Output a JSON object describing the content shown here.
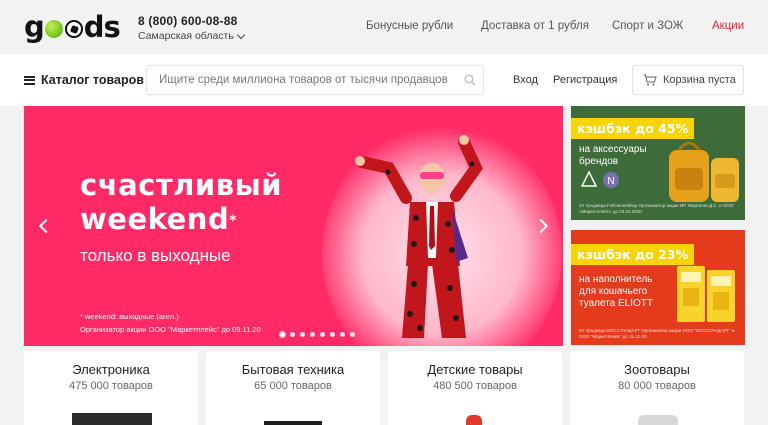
{
  "header": {
    "logo": "goods",
    "phone": "8 (800) 600-08-88",
    "region": "Самарская область",
    "nav": [
      "Бонусные рубли",
      "Доставка от 1 рубля",
      "Спорт и ЗОЖ",
      "Акции"
    ]
  },
  "search": {
    "catalog_label": "Каталог товаров",
    "placeholder": "Ищите среди миллиона товаров от тысячи продавцов",
    "login": "Вход",
    "register": "Регистрация",
    "cart": "Корзина пуста"
  },
  "main_banner": {
    "line1": "счастливый",
    "line2": "weekend",
    "star": "*",
    "subtitle": "только в выходные",
    "fine1": "* weekend: выходные (англ.)",
    "fine2": "Организатор акции ООО \"Маркетплейс\" до 09.11.20",
    "slides_total": 8,
    "active_slide": 1
  },
  "side_banners": [
    {
      "tag": "кэшбэк до 45%",
      "lines": [
        "на аксессуары",
        "брендов"
      ],
      "fine": "От продавца Fullcomedshop Организатор акции ИП Фарпатов Д.С. и ООО «Маркетплейс» до 23.10.2020"
    },
    {
      "tag": "кэшбэк до 23%",
      "lines": [
        "на наполнитель",
        "для кошачьего",
        "туалета ELIOTT"
      ],
      "fine": "От продавца ВОССТАНДАРТ Организатор акции ООО \"ВОССТАНДАРТ\" и ООО \"Маркетплейс\" до 31.10.20"
    }
  ],
  "categories": [
    {
      "name": "Электроника",
      "count": "475 000 товаров"
    },
    {
      "name": "Бытовая техника",
      "count": "65 000 товаров"
    },
    {
      "name": "Детские товары",
      "count": "480 500 товаров"
    },
    {
      "name": "Зоотовары",
      "count": "80 000 товаров"
    }
  ],
  "colors": {
    "accent_red": "#ff2a66",
    "promo_link": "#e5262f",
    "cashback_yellow": "#f7d500",
    "side1_bg": "#3e6b3a",
    "side2_bg": "#e33b1b"
  }
}
